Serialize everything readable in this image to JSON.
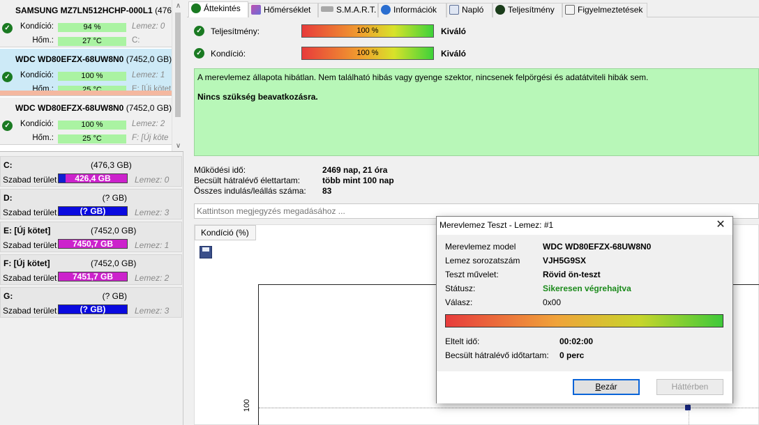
{
  "disks": [
    {
      "name": "SAMSUNG MZ7LN512HCHP-000L1",
      "size": "(476",
      "condition_label": "Kondíció:",
      "condition_value": "94 %",
      "temp_label": "Hőm.:",
      "temp_value": "27 °C",
      "disk_note": "Lemez: 0",
      "drive_note": "C:"
    },
    {
      "name": "WDC WD80EFZX-68UW8N0",
      "size": "(7452,0 GB)",
      "condition_label": "Kondíció:",
      "condition_value": "100 %",
      "temp_label": "Hőm.:",
      "temp_value": "25 °C",
      "disk_note": "Lemez: 1",
      "drive_note": "E: [Új kötet"
    },
    {
      "name": "WDC WD80EFZX-68UW8N0",
      "size": "(7452,0 GB)",
      "condition_label": "Kondíció:",
      "condition_value": "100 %",
      "temp_label": "Hőm.:",
      "temp_value": "25 °C",
      "disk_note": "Lemez: 2",
      "drive_note": "F: [Új köte"
    }
  ],
  "volumes": [
    {
      "name": "C:",
      "size": "(476,3 GB)",
      "free_label": "Szabad terület",
      "free_value": "426,4 GB",
      "note": "Lemez: 0",
      "color": "#cc22cc"
    },
    {
      "name": "D:",
      "size": "(? GB)",
      "free_label": "Szabad terület",
      "free_value": "(? GB)",
      "note": "Lemez: 3",
      "color": "#0a0adf"
    },
    {
      "name": "E: [Új kötet]",
      "size": "(7452,0 GB)",
      "free_label": "Szabad terület",
      "free_value": "7450,7 GB",
      "note": "Lemez: 1",
      "color": "#cc22cc"
    },
    {
      "name": "F: [Új kötet]",
      "size": "(7452,0 GB)",
      "free_label": "Szabad terület",
      "free_value": "7451,7 GB",
      "note": "Lemez: 2",
      "color": "#cc22cc"
    },
    {
      "name": "G:",
      "size": "(? GB)",
      "free_label": "Szabad terület",
      "free_value": "(? GB)",
      "note": "Lemez: 3",
      "color": "#0a0adf"
    }
  ],
  "tabs": [
    {
      "label": "Áttekintés",
      "icon": "check-circle-icon"
    },
    {
      "label": "Hőmérséklet",
      "icon": "thermometer-icon"
    },
    {
      "label": "S.M.A.R.T.",
      "icon": "smart-icon"
    },
    {
      "label": "Információk",
      "icon": "info-icon"
    },
    {
      "label": "Napló",
      "icon": "log-icon"
    },
    {
      "label": "Teljesítmény",
      "icon": "performance-icon"
    },
    {
      "label": "Figyelmeztetések",
      "icon": "warnings-icon"
    }
  ],
  "overview": {
    "performance_label": "Teljesítmény:",
    "performance_percent": "100 %",
    "performance_rating": "Kiváló",
    "condition_label": "Kondíció:",
    "condition_percent": "100 %",
    "condition_rating": "Kiváló",
    "status_text": "A merevlemez állapota hibátlan. Nem található hibás vagy gyenge szektor, nincsenek felpörgési és adatátviteli hibák sem.",
    "status_action": "Nincs szükség beavatkozásra.",
    "uptime_label": "Működési idő:",
    "uptime_value": "2469 nap, 21 óra",
    "lifetime_label": "Becsült hátralévő élettartam:",
    "lifetime_value": "több mint 100 nap",
    "startstop_label": "Összes indulás/leállás száma:",
    "startstop_value": "83",
    "note_placeholder": "Kattintson megjegyzés megadásához ...",
    "chart_tab": "Kondíció  (%)",
    "chart_y_tick": "100"
  },
  "dialog": {
    "title": "Merevlemez Teszt - Lemez: #1",
    "model_label": "Merevlemez model",
    "model_value": "WDC WD80EFZX-68UW8N0",
    "serial_label": "Lemez sorozatszám",
    "serial_value": "VJH5G9SX",
    "op_label": "Teszt művelet:",
    "op_value": "Rövid ön-teszt",
    "status_label": "Státusz:",
    "status_value": "Sikeresen végrehajtva",
    "answer_label": "Válasz:",
    "answer_value": "0x00",
    "elapsed_label": "Eltelt idő:",
    "elapsed_value": "00:02:00",
    "remaining_label": "Becsült hátralévő időtartam:",
    "remaining_value": "0 perc",
    "close_button": "Bezár",
    "background_button": "Háttérben"
  }
}
